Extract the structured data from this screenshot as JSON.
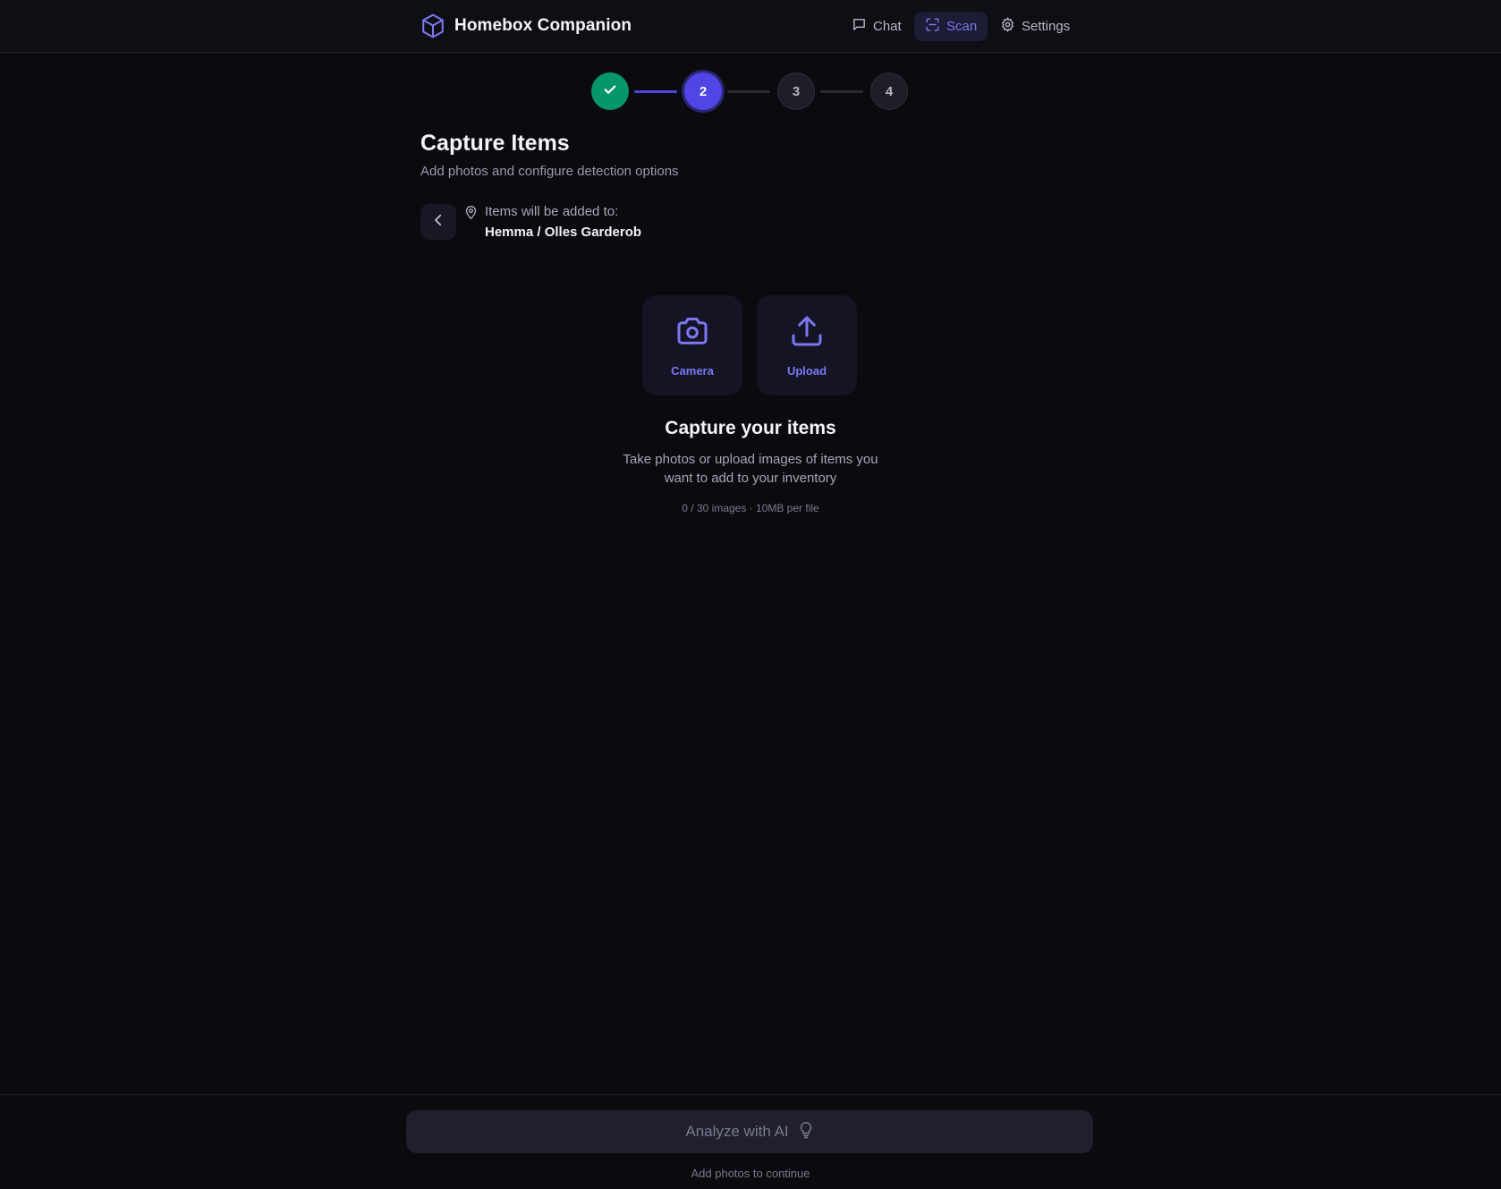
{
  "app": {
    "title": "Homebox Companion",
    "logo_icon": "box-icon"
  },
  "nav": {
    "items": [
      {
        "label": "Chat",
        "icon": "chat-icon",
        "active": false
      },
      {
        "label": "Scan",
        "icon": "scan-icon",
        "active": true
      },
      {
        "label": "Settings",
        "icon": "gear-icon",
        "active": false
      }
    ]
  },
  "stepper": {
    "steps": [
      {
        "label": "",
        "state": "done",
        "icon": "check-icon"
      },
      {
        "label": "2",
        "state": "current"
      },
      {
        "label": "3",
        "state": "todo"
      },
      {
        "label": "4",
        "state": "todo"
      }
    ],
    "current_step": 2,
    "total_steps": 4
  },
  "page": {
    "title": "Capture Items",
    "subtitle": "Add photos and configure detection options"
  },
  "location": {
    "label": "Items will be added to:",
    "path": "Hemma / Olles Garderob",
    "icon": "map-pin-icon"
  },
  "capture": {
    "camera_label": "Camera",
    "upload_label": "Upload"
  },
  "empty_state": {
    "title": "Capture your items",
    "description": "Take photos or upload images of items you want to add to your inventory",
    "limits": "0 / 30 images · 10MB per file"
  },
  "footer": {
    "analyze_label": "Analyze with AI",
    "analyze_icon": "lightbulb-icon",
    "hint": "Add photos to continue"
  },
  "colors": {
    "accent": "#4f46e5",
    "accent_text": "#7c78f2",
    "success": "#079669",
    "background": "#0a0a0f"
  }
}
